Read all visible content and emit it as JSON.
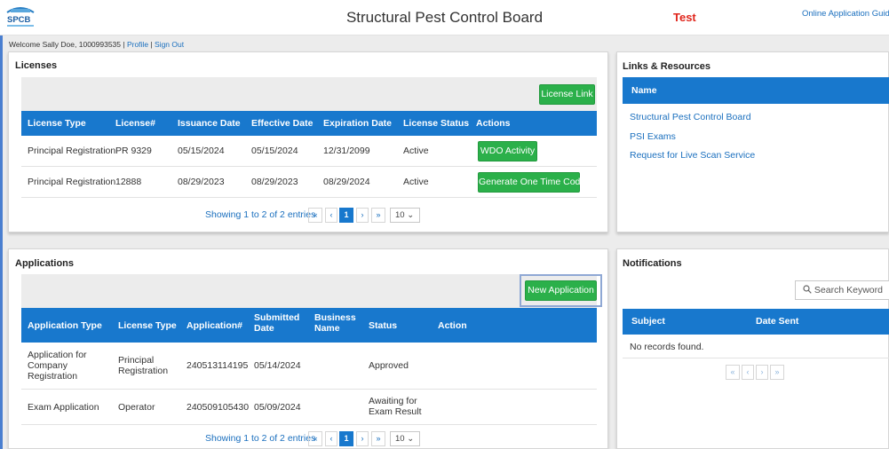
{
  "header": {
    "logo_text": "SPCB",
    "title": "Structural Pest Control Board",
    "env": "Test",
    "guides_link": "Online Application Guides"
  },
  "welcome": {
    "text": "Welcome Sally Doe, 1000993535 |",
    "profile": "Profile",
    "sep": "|",
    "signout": "Sign Out"
  },
  "licenses": {
    "title": "Licenses",
    "link_button": "License Link",
    "columns": [
      "License Type",
      "License#",
      "Issuance Date",
      "Effective Date",
      "Expiration Date",
      "License Status",
      "Actions"
    ],
    "rows": [
      {
        "type": "Principal Registration",
        "num": "PR 9329",
        "issued": "05/15/2024",
        "effective": "05/15/2024",
        "expires": "12/31/2099",
        "status": "Active",
        "action": "WDO Activity"
      },
      {
        "type": "Principal Registration",
        "num": "12888",
        "issued": "08/29/2023",
        "effective": "08/29/2023",
        "expires": "08/29/2024",
        "status": "Active",
        "action": "Generate One Time Code"
      }
    ],
    "pager": {
      "summary": "Showing 1 to 2 of 2 entries",
      "first": "«",
      "prev": "‹",
      "page": "1",
      "next": "›",
      "last": "»",
      "size": "10"
    }
  },
  "links": {
    "title": "Links & Resources",
    "column": "Name",
    "items": [
      "Structural Pest Control Board",
      "PSI Exams",
      "Request for Live Scan Service"
    ]
  },
  "applications": {
    "title": "Applications",
    "new_button": "New Application",
    "columns": [
      "Application Type",
      "License Type",
      "Application#",
      "Submitted Date",
      "Business Name",
      "Status",
      "Action"
    ],
    "rows": [
      {
        "type": "Application for Company Registration",
        "license": "Principal Registration",
        "num": "240513114195",
        "submitted": "05/14/2024",
        "business": "",
        "status": "Approved"
      },
      {
        "type": "Exam Application",
        "license": "Operator",
        "num": "240509105430",
        "submitted": "05/09/2024",
        "business": "",
        "status": "Awaiting for Exam Result"
      }
    ],
    "pager": {
      "summary": "Showing 1 to 2 of 2 entries",
      "first": "«",
      "prev": "‹",
      "page": "1",
      "next": "›",
      "last": "»",
      "size": "10"
    }
  },
  "notifications": {
    "title": "Notifications",
    "search_placeholder": "Search Keyword",
    "columns": [
      "Subject",
      "Date Sent"
    ],
    "empty": "No records found.",
    "pager": {
      "first": "«",
      "prev": "‹",
      "next": "›",
      "last": "»"
    }
  },
  "colors": {
    "accent": "#1878cd",
    "button": "#2bb04a",
    "env": "#e0251b",
    "link": "#1a6fbe"
  }
}
